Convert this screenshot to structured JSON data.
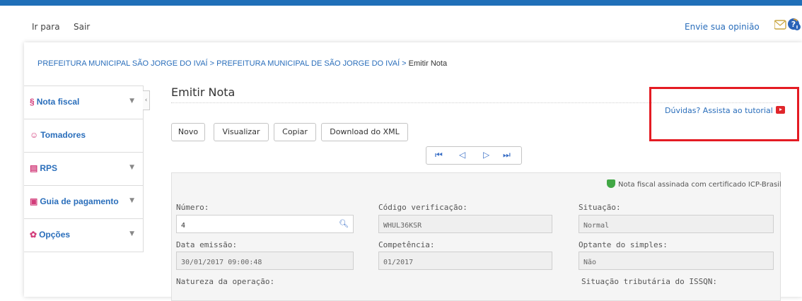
{
  "top_nav": {
    "go_to": "Ir para",
    "exit": "Sair",
    "feedback": "Envie sua opinião"
  },
  "breadcrumb": {
    "part1": "PREFEITURA MUNICIPAL SÃO JORGE DO IVAÍ",
    "sep1": " > ",
    "part2": "PREFEITURA MUNICIPAL DE SÃO JORGE DO IVAÍ",
    "sep2": " > ",
    "current": "Emitir Nota"
  },
  "sidebar": {
    "items": [
      {
        "label": "Nota fiscal",
        "icon": "S"
      },
      {
        "label": "Tomadores",
        "icon": "person-icon"
      },
      {
        "label": "RPS",
        "icon": "list-icon"
      },
      {
        "label": "Guia de pagamento",
        "icon": "receipt-icon"
      },
      {
        "label": "Opções",
        "icon": "gear-icon"
      }
    ]
  },
  "page": {
    "title": "Emitir Nota",
    "tutorial": "Dúvidas? Assista ao tutorial"
  },
  "toolbar": {
    "novo": "Novo",
    "visualizar": "Visualizar",
    "copiar": "Copiar",
    "download": "Download do XML"
  },
  "certificate": "Nota fiscal assinada com certificado ICP-Brasil",
  "form": {
    "numero": {
      "label": "Número:",
      "value": "4"
    },
    "codigo": {
      "label": "Código verificação:",
      "value": "WHUL36KSR"
    },
    "situacao": {
      "label": "Situação:",
      "value": "Normal"
    },
    "data_emissao": {
      "label": "Data emissão:",
      "value": "30/01/2017 09:00:48"
    },
    "competencia": {
      "label": "Competência:",
      "value": "01/2017"
    },
    "optante": {
      "label": "Optante do simples:",
      "value": "Não"
    },
    "natureza": {
      "label": "Natureza da operação:"
    },
    "situacao_issqn": {
      "label": "Situação tributária do ISSQN:"
    }
  },
  "colors": {
    "accent": "#2a6ebb",
    "topbar": "#1f6fb8",
    "highlight": "#e41b23",
    "icon_pink": "#d23c7a"
  }
}
